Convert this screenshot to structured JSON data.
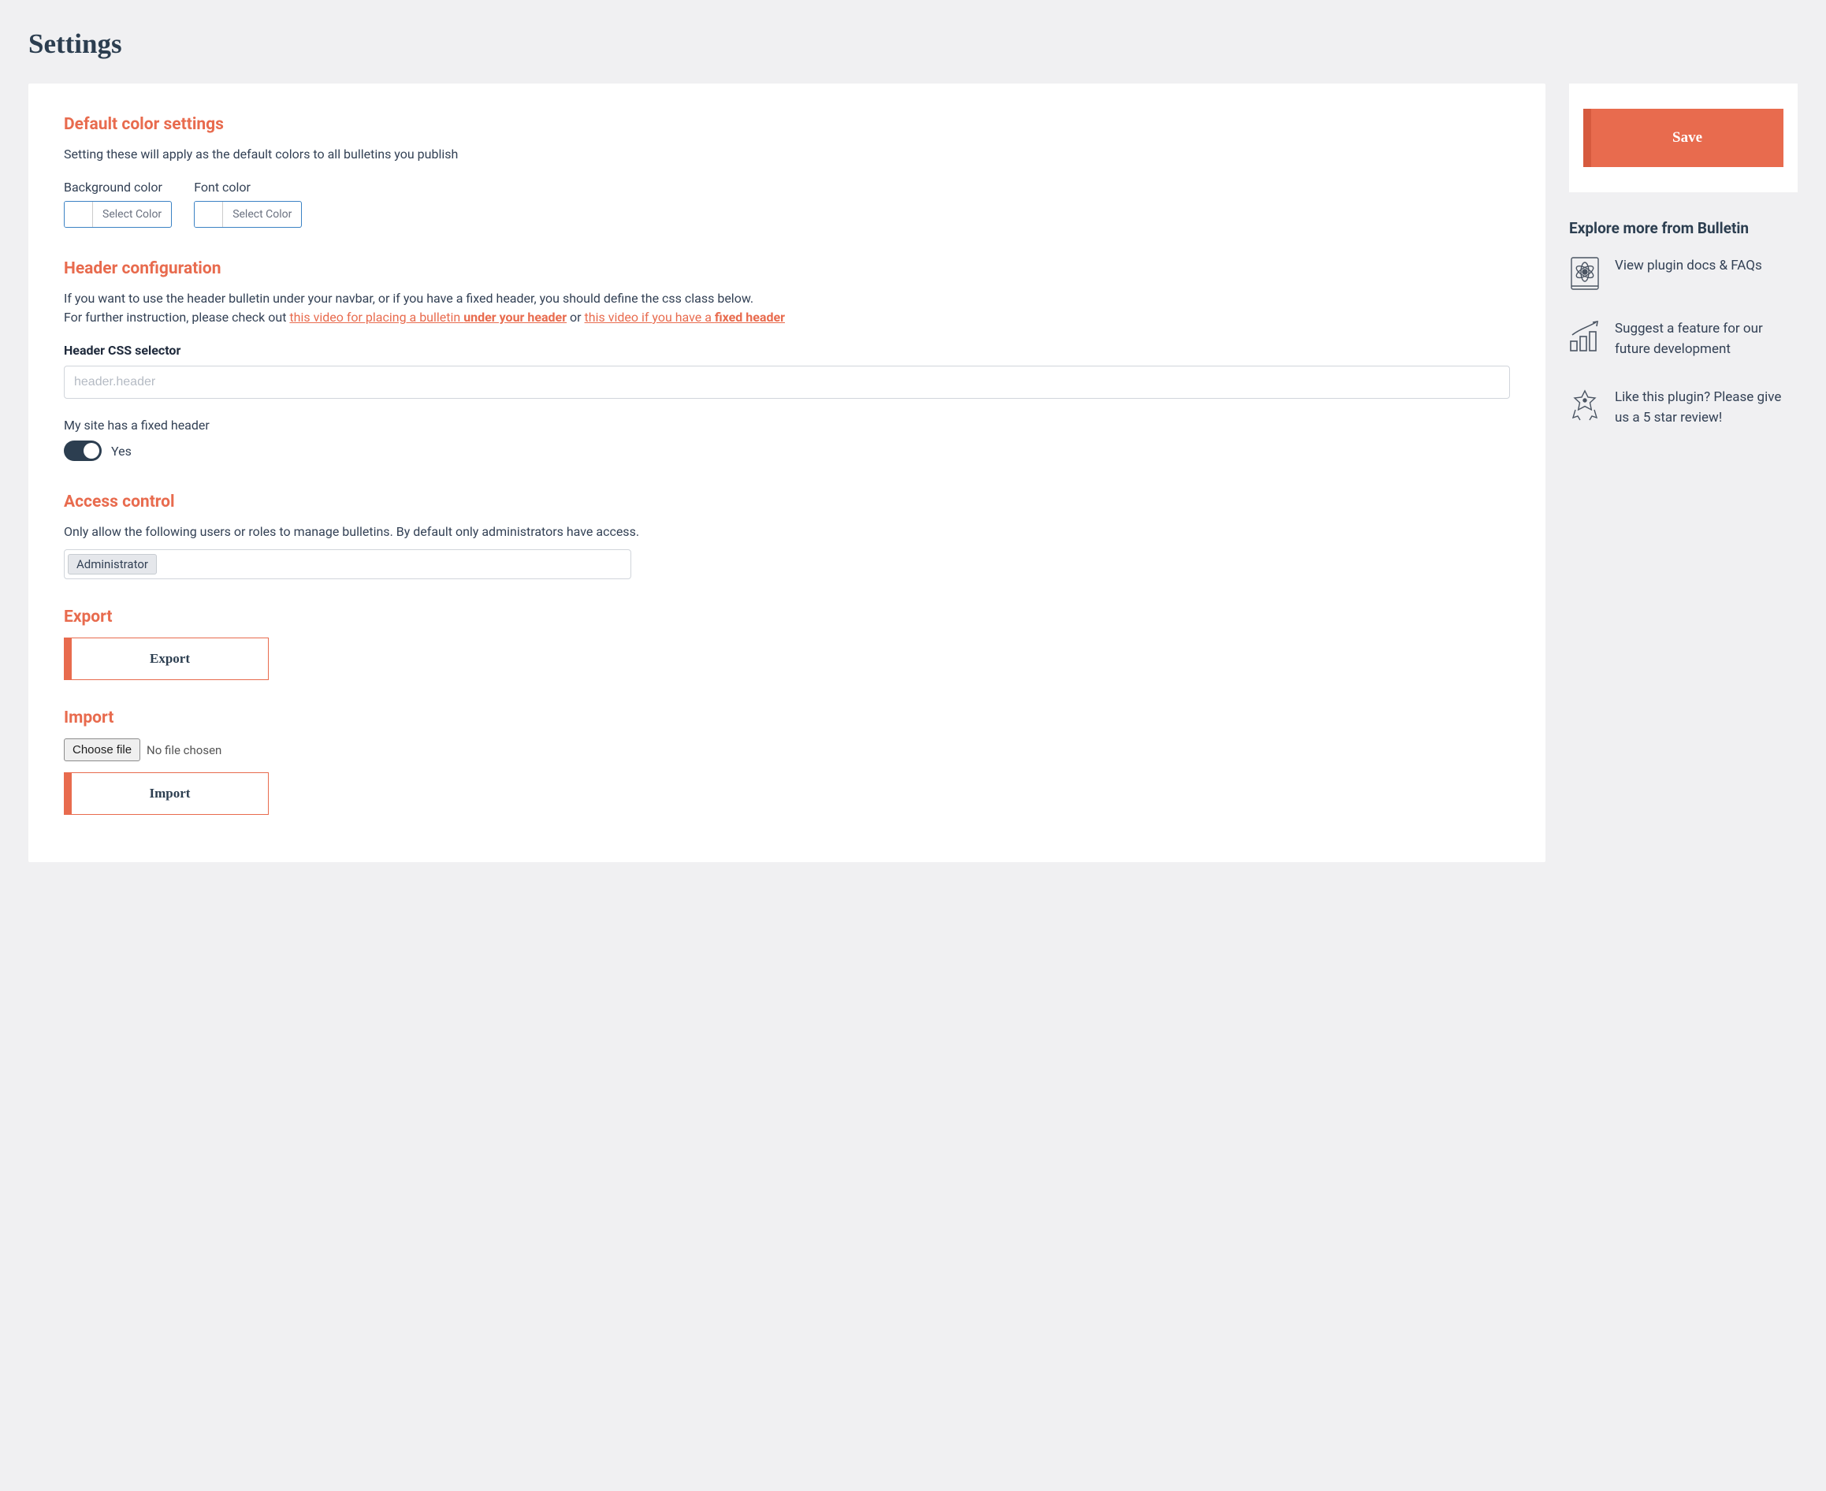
{
  "page": {
    "title": "Settings"
  },
  "colorSection": {
    "heading": "Default color settings",
    "description": "Setting these will apply as the default colors to all bulletins you publish",
    "bgLabel": "Background color",
    "fontLabel": "Font color",
    "selectLabel": "Select Color"
  },
  "headerConfig": {
    "heading": "Header configuration",
    "descPart1": "If you want to use the header bulletin under your navbar, or if you have a fixed header, you should define the css class below.",
    "descPart2a": "For further instruction, please check out ",
    "link1a": "this video for placing a bulletin ",
    "link1b": "under your header",
    "descPart2b": " or ",
    "link2a": "this video if you have a ",
    "link2b": "fixed header",
    "fieldLabel": "Header CSS selector",
    "placeholder": "header.header",
    "fixedHeaderLabel": "My site has a fixed header",
    "toggleState": "Yes"
  },
  "accessControl": {
    "heading": "Access control",
    "description": "Only allow the following users or roles to manage bulletins. By default only administrators have access.",
    "tag": "Administrator"
  },
  "exportSection": {
    "heading": "Export",
    "buttonLabel": "Export"
  },
  "importSection": {
    "heading": "Import",
    "chooseFile": "Choose file",
    "noFile": "No file chosen",
    "buttonLabel": "Import"
  },
  "sidebar": {
    "saveLabel": "Save",
    "exploreHeading": "Explore more from Bulletin",
    "link1": "View plugin docs & FAQs",
    "link2": "Suggest a feature for our future development",
    "link3": "Like this plugin? Please give us a 5 star review!"
  }
}
